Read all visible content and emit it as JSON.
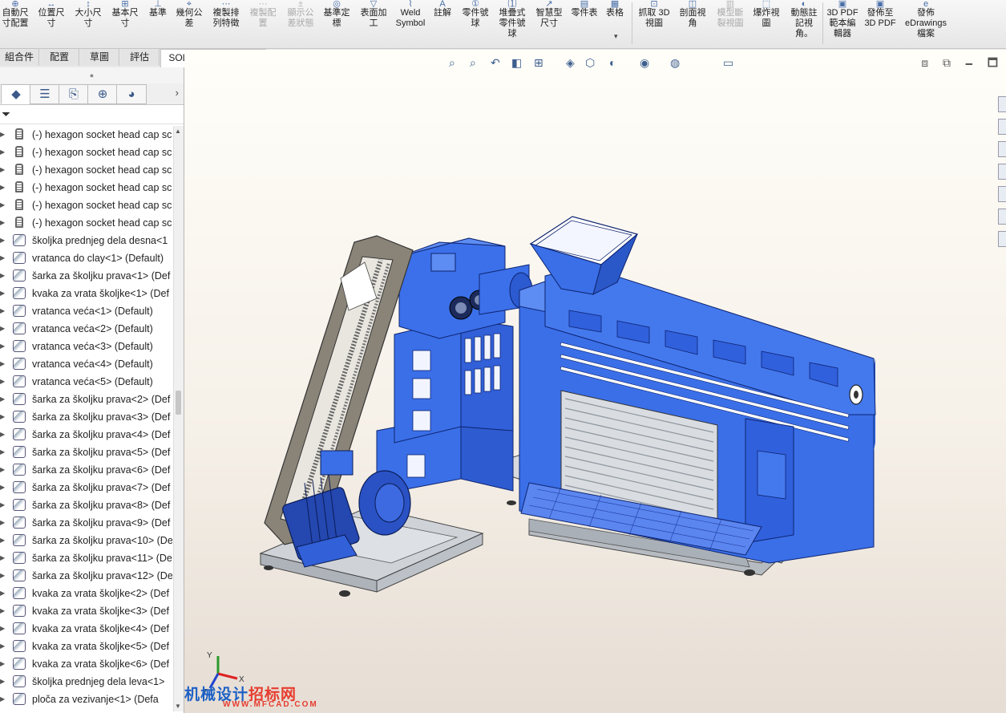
{
  "ribbon": {
    "buttons": [
      {
        "label": "自動尺\n寸配置",
        "icon": "auto-dimension-icon",
        "dim": false
      },
      {
        "label": "位置尺\n寸",
        "icon": "location-dimension-icon",
        "dim": false
      },
      {
        "label": "大小尺\n寸",
        "icon": "size-dimension-icon",
        "dim": false
      },
      {
        "label": "基本尺\n寸",
        "icon": "basic-dimension-icon",
        "dim": false
      },
      {
        "label": "基準",
        "icon": "datum-icon",
        "dim": false
      },
      {
        "label": "幾何公\n差",
        "icon": "geometric-tolerance-icon",
        "dim": false
      },
      {
        "label": "複製排\n列特徵",
        "icon": "copy-pattern-icon",
        "dim": false
      },
      {
        "label": "複製配\n置",
        "icon": "copy-scheme-icon",
        "dim": true
      },
      {
        "label": "顯示公\n差狀態",
        "icon": "tolerance-status-icon",
        "dim": true
      },
      {
        "label": "基準定\n標",
        "icon": "datum-target-icon",
        "dim": false
      },
      {
        "label": "表面加\n工",
        "icon": "surface-finish-icon",
        "dim": false
      },
      {
        "label": "Weld\nSymbol",
        "icon": "weld-symbol-icon",
        "dim": false
      },
      {
        "label": "註解",
        "icon": "note-icon",
        "dim": false
      },
      {
        "label": "零件號\n球",
        "icon": "balloon-icon",
        "dim": false
      },
      {
        "label": "堆疊式\n零件號\n球",
        "icon": "stacked-balloon-icon",
        "dim": false
      },
      {
        "label": "智慧型\n尺寸",
        "icon": "smart-dimension-icon",
        "dim": false
      },
      {
        "label": "零件表",
        "icon": "bom-icon",
        "dim": false
      },
      {
        "label": "表格",
        "icon": "table-icon",
        "dim": false
      },
      {
        "label": "抓取 3D\n視圖",
        "icon": "capture-3d-view-icon",
        "dim": false
      },
      {
        "label": "剖面視\n角",
        "icon": "section-view-icon",
        "dim": false
      },
      {
        "label": "模型斷\n裂視圖",
        "icon": "model-break-view-icon",
        "dim": true
      },
      {
        "label": "爆炸視\n圖",
        "icon": "exploded-view-icon",
        "dim": false
      },
      {
        "label": "動態註\n記視\n角。",
        "icon": "dynamic-annotation-view-icon",
        "dim": false
      },
      {
        "label": "3D PDF\n範本編\n輯器",
        "icon": "3d-pdf-template-icon",
        "dim": false
      },
      {
        "label": "發佈至\n3D PDF",
        "icon": "publish-3d-pdf-icon",
        "dim": false
      },
      {
        "label": "發佈\neDrawings\n檔案",
        "icon": "edrawings-icon",
        "dim": false
      }
    ]
  },
  "tabs": [
    {
      "label": "組合件",
      "active": false
    },
    {
      "label": "配置",
      "active": false
    },
    {
      "label": "草圖",
      "active": false
    },
    {
      "label": "評估",
      "active": false
    },
    {
      "label": "SOLIDWORKS MBD",
      "active": true
    }
  ],
  "panel": {
    "tabs": [
      "feature-manager-icon",
      "property-manager-icon",
      "configuration-manager-icon",
      "dimxpert-manager-icon",
      "display-manager-icon"
    ],
    "filter_icon": "filter-icon",
    "tree": [
      {
        "label": "(-) hexagon socket head cap sc",
        "icon": "bolt"
      },
      {
        "label": "(-) hexagon socket head cap sc",
        "icon": "bolt"
      },
      {
        "label": "(-) hexagon socket head cap sc",
        "icon": "bolt"
      },
      {
        "label": "(-) hexagon socket head cap sc",
        "icon": "bolt"
      },
      {
        "label": "(-) hexagon socket head cap sc",
        "icon": "bolt"
      },
      {
        "label": "(-) hexagon socket head cap sc",
        "icon": "bolt"
      },
      {
        "label": "školjka prednjeg dela desna<1",
        "icon": "part"
      },
      {
        "label": "vratanca do clay<1> (Default)",
        "icon": "part"
      },
      {
        "label": "šarka za školjku prava<1> (Def",
        "icon": "part"
      },
      {
        "label": "kvaka za vrata školjke<1> (Def",
        "icon": "part"
      },
      {
        "label": "vratanca veća<1> (Default)",
        "icon": "part"
      },
      {
        "label": "vratanca veća<2> (Default)",
        "icon": "part"
      },
      {
        "label": "vratanca veća<3> (Default)",
        "icon": "part"
      },
      {
        "label": "vratanca veća<4> (Default)",
        "icon": "part"
      },
      {
        "label": "vratanca veća<5> (Default)",
        "icon": "part"
      },
      {
        "label": "šarka za školjku prava<2> (Def",
        "icon": "part"
      },
      {
        "label": "šarka za školjku prava<3> (Def",
        "icon": "part"
      },
      {
        "label": "šarka za školjku prava<4> (Def",
        "icon": "part"
      },
      {
        "label": "šarka za školjku prava<5> (Def",
        "icon": "part"
      },
      {
        "label": "šarka za školjku prava<6> (Def",
        "icon": "part"
      },
      {
        "label": "šarka za školjku prava<7> (Def",
        "icon": "part"
      },
      {
        "label": "šarka za školjku prava<8> (Def",
        "icon": "part"
      },
      {
        "label": "šarka za školjku prava<9> (Def",
        "icon": "part"
      },
      {
        "label": "šarka za školjku prava<10> (De",
        "icon": "part"
      },
      {
        "label": "šarka za školjku prava<11> (De",
        "icon": "part"
      },
      {
        "label": "šarka za školjku prava<12> (De",
        "icon": "part"
      },
      {
        "label": "kvaka za vrata školjke<2> (Def",
        "icon": "part"
      },
      {
        "label": "kvaka za vrata školjke<3> (Def",
        "icon": "part"
      },
      {
        "label": "kvaka za vrata školjke<4> (Def",
        "icon": "part"
      },
      {
        "label": "kvaka za vrata školjke<5> (Def",
        "icon": "part"
      },
      {
        "label": "kvaka za vrata školjke<6> (Def",
        "icon": "part"
      },
      {
        "label": "školjka prednjeg dela leva<1>",
        "icon": "part"
      },
      {
        "label": "ploča za vezivanje<1> (Defa",
        "icon": "part"
      }
    ]
  },
  "viewport": {
    "toolbar_icons": [
      "zoom-to-fit-icon",
      "zoom-to-area-icon",
      "previous-view-icon",
      "section-view-icon",
      "dynamic-annotation-icon",
      "view-orientation-icon",
      "display-style-icon",
      "hide-show-icon",
      "edit-appearance-icon",
      "apply-scene-icon",
      "view-settings-icon"
    ],
    "window_controls": [
      "restore-view-icon",
      "tile-view-icon",
      "minimize-icon",
      "maximize-icon"
    ],
    "watermark": {
      "main": "机械设计",
      "accent": "招标网",
      "sub": "WWW.MFCAD.COM"
    },
    "triad": {
      "x": "X",
      "y": "Y",
      "z": "Z"
    },
    "colors": {
      "body": "#3a6fe8",
      "body_dark": "#1e3f9c",
      "frame": "#c9cdd3",
      "belt": "#8a8478",
      "motor": "#2447b0"
    }
  }
}
